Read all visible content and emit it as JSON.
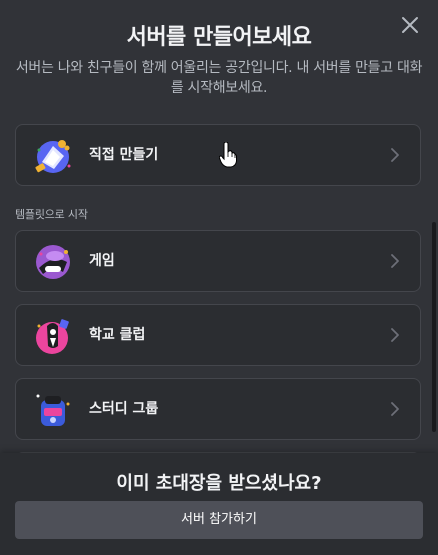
{
  "modal": {
    "title": "서버를 만들어보세요",
    "subtitle": "서버는 나와 친구들이 함께 어울리는 공간입니다. 내 서버를 만들고 대화를 시작해보세요.",
    "close_icon": "close-icon"
  },
  "create_own": {
    "label": "직접 만들기",
    "icon": "create-server-icon"
  },
  "templates": {
    "section_label": "템플릿으로 시작",
    "items": [
      {
        "label": "게임",
        "icon": "gaming-template-icon"
      },
      {
        "label": "학교 클럽",
        "icon": "school-club-template-icon"
      },
      {
        "label": "스터디 그룹",
        "icon": "study-group-template-icon"
      }
    ]
  },
  "footer": {
    "title": "이미 초대장을 받으셨나요?",
    "join_button_label": "서버 참가하기"
  },
  "colors": {
    "background": "#313338",
    "card": "#2b2d31",
    "card_border": "#44464c",
    "footer": "#2b2d31",
    "button": "#4e5058",
    "heading": "#f2f3f5",
    "muted": "#b5bac1"
  }
}
